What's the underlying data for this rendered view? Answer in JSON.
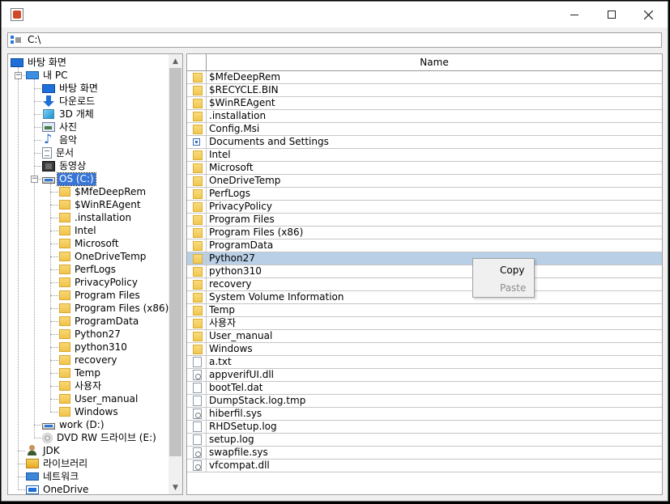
{
  "window": {
    "minimize_icon": "minimize-icon",
    "maximize_icon": "maximize-icon",
    "close_icon": "close-icon"
  },
  "pathbar": {
    "value": "C:\\"
  },
  "tree": {
    "items": [
      {
        "label": "바탕 화면",
        "icon": "desktop-icon"
      },
      {
        "label": "내 PC",
        "icon": "pc-icon"
      },
      {
        "label": "바탕 화면",
        "icon": "desktop-icon"
      },
      {
        "label": "다운로드",
        "icon": "download-icon"
      },
      {
        "label": "3D 개체",
        "icon": "3d-objects-icon"
      },
      {
        "label": "사진",
        "icon": "pictures-icon"
      },
      {
        "label": "음악",
        "icon": "music-icon"
      },
      {
        "label": "문서",
        "icon": "documents-icon"
      },
      {
        "label": "동영상",
        "icon": "videos-icon"
      },
      {
        "label": "OS (C:)",
        "icon": "drive-icon"
      },
      {
        "label": "$MfeDeepRem",
        "icon": "folder-icon"
      },
      {
        "label": "$WinREAgent",
        "icon": "folder-icon"
      },
      {
        "label": ".installation",
        "icon": "folder-icon"
      },
      {
        "label": "Intel",
        "icon": "folder-icon"
      },
      {
        "label": "Microsoft",
        "icon": "folder-icon"
      },
      {
        "label": "OneDriveTemp",
        "icon": "folder-icon"
      },
      {
        "label": "PerfLogs",
        "icon": "folder-icon"
      },
      {
        "label": "PrivacyPolicy",
        "icon": "folder-icon"
      },
      {
        "label": "Program Files",
        "icon": "folder-icon"
      },
      {
        "label": "Program Files (x86)",
        "icon": "folder-icon"
      },
      {
        "label": "ProgramData",
        "icon": "folder-icon"
      },
      {
        "label": "Python27",
        "icon": "folder-icon"
      },
      {
        "label": "python310",
        "icon": "folder-icon"
      },
      {
        "label": "recovery",
        "icon": "folder-icon"
      },
      {
        "label": "Temp",
        "icon": "folder-icon"
      },
      {
        "label": "사용자",
        "icon": "folder-icon"
      },
      {
        "label": "User_manual",
        "icon": "folder-icon"
      },
      {
        "label": "Windows",
        "icon": "folder-icon"
      },
      {
        "label": "work (D:)",
        "icon": "drive-icon"
      },
      {
        "label": "DVD RW 드라이브 (E:)",
        "icon": "dvd-icon"
      },
      {
        "label": "JDK",
        "icon": "user-icon"
      },
      {
        "label": "라이브러리",
        "icon": "library-icon"
      },
      {
        "label": "네트워크",
        "icon": "network-icon"
      },
      {
        "label": "OneDrive",
        "icon": "onedrive-icon"
      }
    ]
  },
  "list": {
    "header": "Name",
    "rows": [
      {
        "name": "$MfeDeepRem",
        "type": "folder"
      },
      {
        "name": "$RECYCLE.BIN",
        "type": "folder"
      },
      {
        "name": "$WinREAgent",
        "type": "folder"
      },
      {
        "name": ".installation",
        "type": "folder"
      },
      {
        "name": "Config.Msi",
        "type": "folder"
      },
      {
        "name": "Documents and Settings",
        "type": "shortcut"
      },
      {
        "name": "Intel",
        "type": "folder"
      },
      {
        "name": "Microsoft",
        "type": "folder"
      },
      {
        "name": "OneDriveTemp",
        "type": "folder"
      },
      {
        "name": "PerfLogs",
        "type": "folder"
      },
      {
        "name": "PrivacyPolicy",
        "type": "folder"
      },
      {
        "name": "Program Files",
        "type": "folder"
      },
      {
        "name": "Program Files (x86)",
        "type": "folder"
      },
      {
        "name": "ProgramData",
        "type": "folder"
      },
      {
        "name": "Python27",
        "type": "folder"
      },
      {
        "name": "python310",
        "type": "folder"
      },
      {
        "name": "recovery",
        "type": "folder"
      },
      {
        "name": "System Volume Information",
        "type": "folder"
      },
      {
        "name": "Temp",
        "type": "folder"
      },
      {
        "name": "사용자",
        "type": "folder"
      },
      {
        "name": "User_manual",
        "type": "folder"
      },
      {
        "name": "Windows",
        "type": "folder"
      },
      {
        "name": "a.txt",
        "type": "file"
      },
      {
        "name": "appverifUI.dll",
        "type": "sysfile"
      },
      {
        "name": "bootTel.dat",
        "type": "file"
      },
      {
        "name": "DumpStack.log.tmp",
        "type": "file"
      },
      {
        "name": "hiberfil.sys",
        "type": "sysfile"
      },
      {
        "name": "RHDSetup.log",
        "type": "file"
      },
      {
        "name": "setup.log",
        "type": "file"
      },
      {
        "name": "swapfile.sys",
        "type": "sysfile"
      },
      {
        "name": "vfcompat.dll",
        "type": "sysfile"
      }
    ]
  },
  "context_menu": {
    "copy_label": "Copy",
    "paste_label": "Paste"
  }
}
